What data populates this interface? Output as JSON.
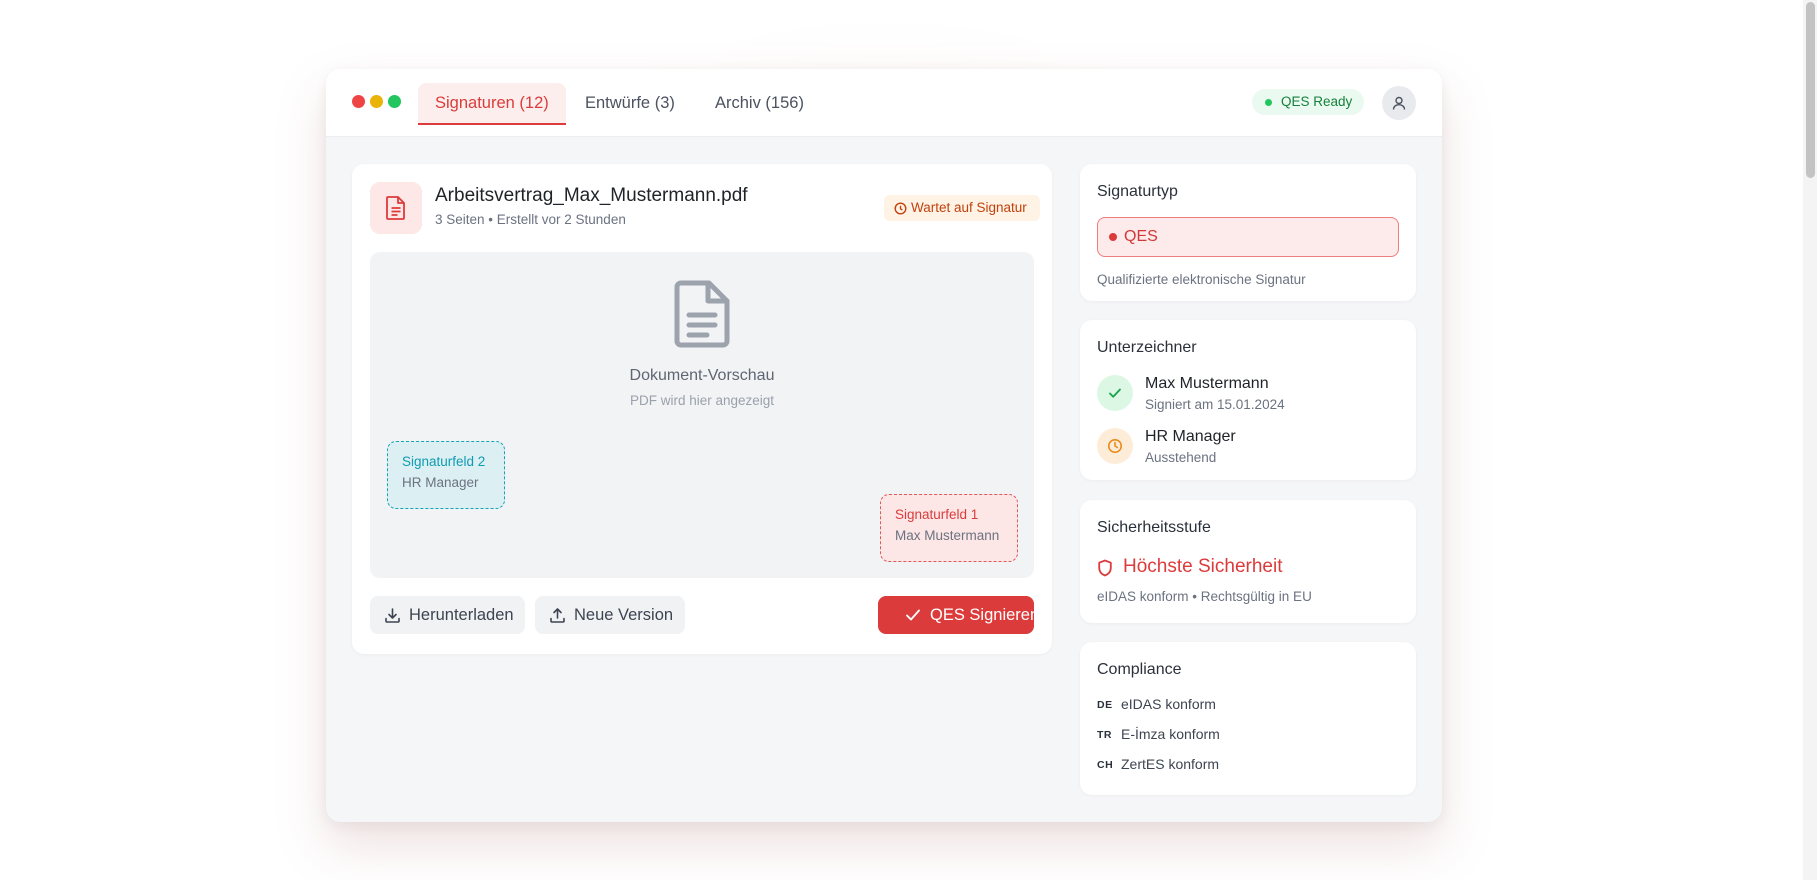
{
  "tabs": [
    {
      "label": "Signaturen (12)",
      "active": true
    },
    {
      "label": "Entwürfe (3)",
      "active": false
    },
    {
      "label": "Archiv (156)",
      "active": false
    }
  ],
  "header": {
    "status_label": "QES Ready"
  },
  "document": {
    "file_name": "Arbeitsvertrag_Max_Mustermann.pdf",
    "meta": "3 Seiten • Erstellt vor 2 Stunden",
    "status": "Wartet auf Signatur",
    "preview_title": "Dokument-Vorschau",
    "preview_subtitle": "PDF wird hier angezeigt",
    "signature_fields": [
      {
        "label": "Signaturfeld 2",
        "signer": "HR Manager"
      },
      {
        "label": "Signaturfeld 1",
        "signer": "Max Mustermann"
      }
    ],
    "actions": {
      "download": "Herunterladen",
      "new_version": "Neue Version",
      "sign": "QES Signieren"
    }
  },
  "signature_type": {
    "title": "Signaturtyp",
    "selected": "QES",
    "description": "Qualifizierte elektronische Signatur"
  },
  "signers": {
    "title": "Unterzeichner",
    "items": [
      {
        "name": "Max Mustermann",
        "status": "Signiert am 15.01.2024",
        "state": "signed"
      },
      {
        "name": "HR Manager",
        "status": "Ausstehend",
        "state": "pending"
      }
    ]
  },
  "security": {
    "title": "Sicherheitsstufe",
    "level": "Höchste Sicherheit",
    "description": "eIDAS konform • Rechtsgültig in EU"
  },
  "compliance": {
    "title": "Compliance",
    "items": [
      {
        "code": "DE",
        "label": "eIDAS konform"
      },
      {
        "code": "TR",
        "label": "E-İmza konform"
      },
      {
        "code": "CH",
        "label": "ZertES konform"
      }
    ]
  },
  "colors": {
    "accent": "#dc3b3b",
    "success": "#22c55e",
    "warning": "#f59e0b",
    "teal": "#16a3b8"
  }
}
